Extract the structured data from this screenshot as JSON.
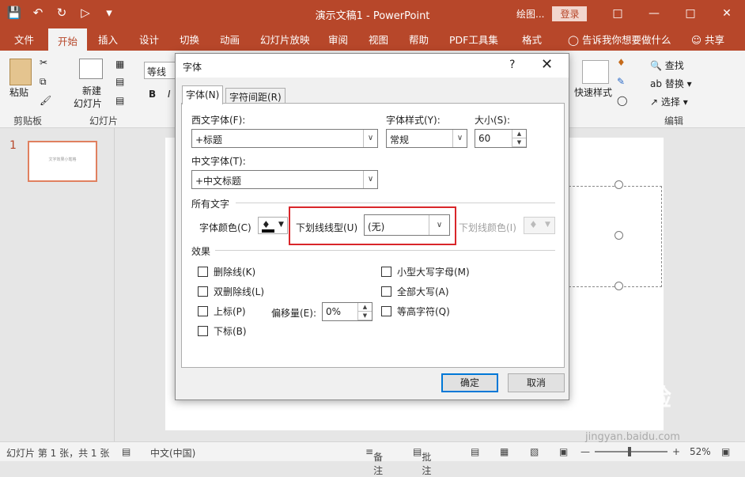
{
  "window": {
    "doc_title": "演示文稿1 - PowerPoint",
    "user_short": "绘图...",
    "login_label": "登录"
  },
  "qat": {
    "save": "save-icon",
    "undo": "undo-icon",
    "redo": "redo-icon",
    "present": "present-icon",
    "customize": "customize-icon"
  },
  "tabs": [
    "文件",
    "开始",
    "插入",
    "设计",
    "切换",
    "动画",
    "幻灯片放映",
    "审阅",
    "视图",
    "帮助",
    "PDF工具集",
    "格式"
  ],
  "active_tab": "开始",
  "tell_me": "告诉我你想要做什么",
  "share": "共享",
  "ribbon": {
    "paste": "粘贴",
    "clipboard": "剪贴板",
    "new_slide_line1": "新建",
    "new_slide_line2": "幻灯片",
    "slides_group": "幻灯片",
    "font_box": "等线",
    "quick_styles": "快速样式",
    "find": "查找",
    "replace": "替换",
    "select": "选择",
    "editing": "编辑"
  },
  "slides": {
    "number": "1",
    "thumb_text": "文字效果小笔格"
  },
  "statusbar": {
    "slide_info": "幻灯片 第 1 张，共 1 张",
    "language": "中文(中国)",
    "notes": "备注",
    "comments": "批注",
    "zoom": "52%"
  },
  "dialog": {
    "title": "字体",
    "help": "?",
    "tabs": [
      "字体(N)",
      "字符间距(R)"
    ],
    "western_font_label": "西文字体(F):",
    "western_font_value": "+标题",
    "style_label": "字体样式(Y):",
    "style_value": "常规",
    "size_label": "大小(S):",
    "size_value": "60",
    "asian_font_label": "中文字体(T):",
    "asian_font_value": "+中文标题",
    "all_text": "所有文字",
    "font_color_label": "字体颜色(C)",
    "underline_style_label": "下划线线型(U)",
    "underline_style_value": "(无)",
    "underline_color_label": "下划线颜色(I)",
    "effects": "效果",
    "effects_left": [
      "删除线(K)",
      "双删除线(L)",
      "上标(P)",
      "下标(B)"
    ],
    "effects_right": [
      "小型大写字母(M)",
      "全部大写(A)",
      "等高字符(Q)"
    ],
    "offset_label": "偏移量(E):",
    "offset_value": "0%",
    "ok": "确定",
    "cancel": "取消"
  },
  "watermark": {
    "text": "Bai 经验",
    "url": "jingyan.baidu.com"
  },
  "colors": {
    "accent": "#b7472a",
    "highlight": "#d9262a",
    "default_btn": "#0078d7"
  }
}
